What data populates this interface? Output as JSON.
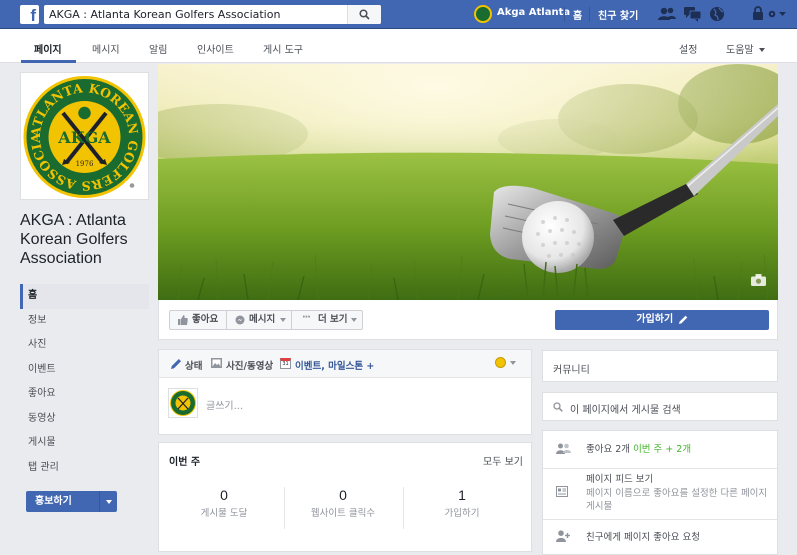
{
  "topbar": {
    "search_value": "AKGA : Atlanta Korean Golfers Association",
    "profile_name": "Akga Atlanta",
    "home": "홈",
    "find_friends": "친구 찾기"
  },
  "page_tabs": {
    "items": [
      "페이지",
      "메시지",
      "알림",
      "인사이트",
      "게시 도구"
    ],
    "settings": "설정",
    "help": "도움말"
  },
  "page": {
    "name": "AKGA : Atlanta Korean Golfers Association"
  },
  "logo": {
    "ring_text": "ATLANTA KOREAN GOLFERS ASSOCIATION",
    "center": "AKGA",
    "year": "1976"
  },
  "left_nav": {
    "items": [
      "홈",
      "정보",
      "사진",
      "이벤트",
      "좋아요",
      "동영상",
      "게시물",
      "탭 관리"
    ],
    "promote": "홍보하기"
  },
  "cover_actions": {
    "like": "좋아요",
    "message": "메시지",
    "more": "더 보기",
    "join": "가입하기"
  },
  "composer": {
    "status": "상태",
    "photo_video": "사진/동영상",
    "event": "이벤트, 마일스톤 +",
    "calendar_day": "31",
    "placeholder": "글쓰기..."
  },
  "this_week": {
    "title": "이번 주",
    "see_all": "모두 보기",
    "stats": [
      {
        "value": "0",
        "label": "게시물 도달"
      },
      {
        "value": "0",
        "label": "웹사이트 클릭수"
      },
      {
        "value": "1",
        "label": "가입하기"
      }
    ]
  },
  "right": {
    "community": "커뮤니티",
    "search_placeholder": "이 페이지에서 게시물 검색",
    "likes_text": "좋아요 2개",
    "likes_week": "이번 주 + 2개",
    "feed_title": "페이지 피드 보기",
    "feed_desc": "페이지 이름으로 좋아요를 설정한 다른 페이지 게시물",
    "invite": "친구에게 페이지 좋아요 요청"
  },
  "colors": {
    "brand": "#4267b2",
    "logo_green": "#1a6b2f",
    "logo_gold": "#f2c300"
  }
}
